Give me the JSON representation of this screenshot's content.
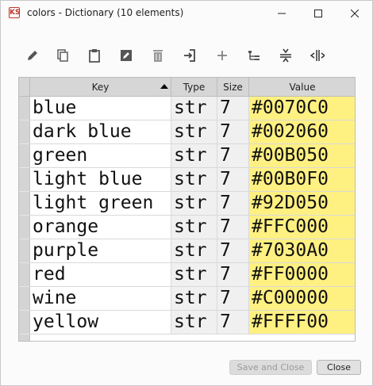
{
  "window": {
    "title": "colors - Dictionary (10 elements)",
    "app_icon_text": "KS"
  },
  "toolbar": {
    "icons": [
      "edit-pencil-icon",
      "copy-icon",
      "paste-clipboard-icon",
      "edit-image-icon",
      "delete-trash-icon",
      "import-icon",
      "add-icon",
      "tree-view-icon",
      "collapse-icon",
      "expand-icon"
    ]
  },
  "table": {
    "headers": {
      "key": "Key",
      "type": "Type",
      "size": "Size",
      "value": "Value"
    },
    "sort": {
      "column": "Key",
      "direction": "ascending"
    },
    "rows": [
      {
        "key": "blue",
        "type": "str",
        "size": "7",
        "value": "#0070C0"
      },
      {
        "key": "dark blue",
        "type": "str",
        "size": "7",
        "value": "#002060"
      },
      {
        "key": "green",
        "type": "str",
        "size": "7",
        "value": "#00B050"
      },
      {
        "key": "light blue",
        "type": "str",
        "size": "7",
        "value": "#00B0F0"
      },
      {
        "key": "light green",
        "type": "str",
        "size": "7",
        "value": "#92D050"
      },
      {
        "key": "orange",
        "type": "str",
        "size": "7",
        "value": "#FFC000"
      },
      {
        "key": "purple",
        "type": "str",
        "size": "7",
        "value": "#7030A0"
      },
      {
        "key": "red",
        "type": "str",
        "size": "7",
        "value": "#FF0000"
      },
      {
        "key": "wine",
        "type": "str",
        "size": "7",
        "value": "#C00000"
      },
      {
        "key": "yellow",
        "type": "str",
        "size": "7",
        "value": "#FFFF00"
      }
    ]
  },
  "footer": {
    "save_label": "Save and Close",
    "close_label": "Close"
  },
  "colors": {
    "value_cell_bg": "#fff082",
    "header_bg": "#d6d6d6"
  }
}
